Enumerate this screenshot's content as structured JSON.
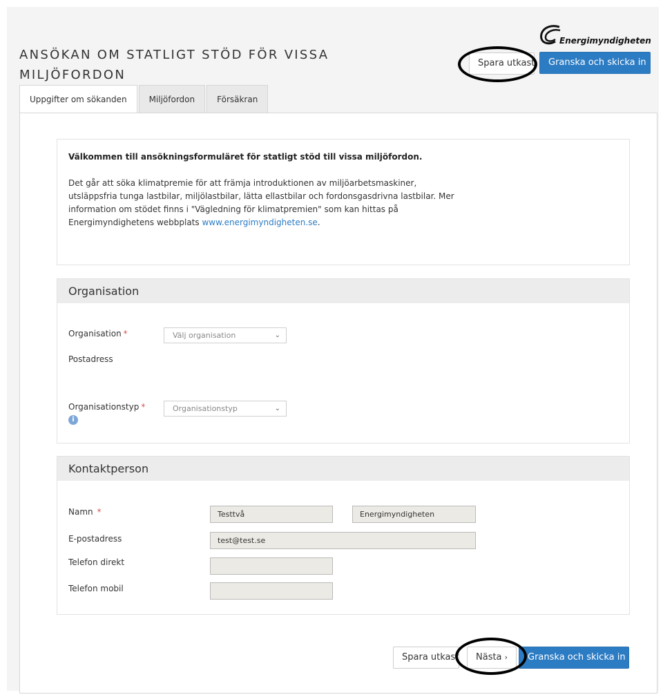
{
  "header": {
    "logo_text": "Energimyndigheten",
    "title": "ANSÖKAN OM STATLIGT STÖD FÖR VISSA MILJÖFORDON",
    "save_draft_label": "Spara utkast",
    "review_submit_label": "Granska och skicka in"
  },
  "tabs": [
    {
      "label": "Uppgifter om sökanden",
      "active": true
    },
    {
      "label": "Miljöfordon",
      "active": false
    },
    {
      "label": "Försäkran",
      "active": false
    }
  ],
  "intro": {
    "heading": "Välkommen till ansökningsformuläret för statligt stöd till vissa miljöfordon.",
    "body": "Det går att söka klimatpremie för att främja introduktionen av miljöarbetsmaskiner, utsläppsfria tunga lastbilar, miljölastbilar, lätta ellastbilar och fordonsgasdrivna lastbilar. Mer information om stödet finns i \"Vägledning för klimatpremien\" som kan hittas på Energimyndighetens webbplats",
    "link": "www.energimyndigheten.se",
    "link_suffix": "."
  },
  "organisation": {
    "section_title": "Organisation",
    "org_label": "Organisation",
    "org_placeholder": "Välj organisation",
    "postal_label": "Postadress",
    "type_label": "Organisationstyp",
    "type_placeholder": "Organisationstyp",
    "required_mark": "*",
    "info_icon": "i"
  },
  "contact": {
    "section_title": "Kontaktperson",
    "name_label": "Namn",
    "first_name": "Testtvå",
    "last_name": "Energimyndigheten",
    "email_label": "E-postadress",
    "email": "test@test.se",
    "phone_direct_label": "Telefon direkt",
    "phone_direct": "",
    "phone_mobile_label": "Telefon mobil",
    "phone_mobile": "",
    "required_mark": "*"
  },
  "footer": {
    "save_draft_label": "Spara utkast",
    "next_label": "Nästa",
    "next_icon": "›",
    "review_submit_label": "Granska och skicka in"
  },
  "colors": {
    "primary": "#2c7cc4",
    "required": "#d9534f",
    "readonly_input": "#eceae4"
  },
  "icons": {
    "chevron": "chevron-down-icon",
    "info": "info-icon",
    "logo": "energimyndigheten-logo-icon"
  }
}
